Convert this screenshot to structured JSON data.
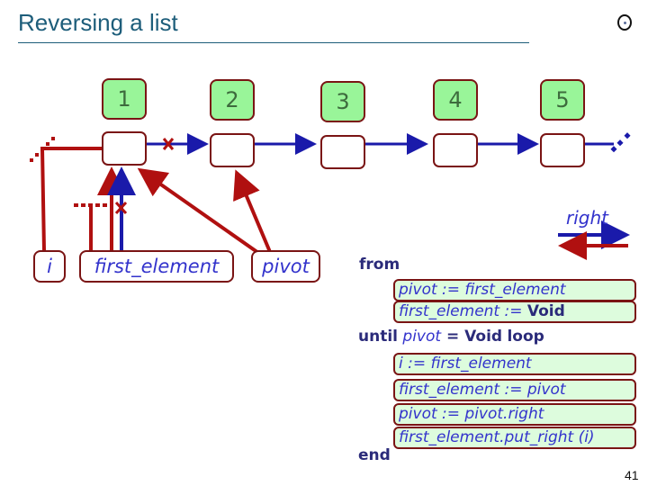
{
  "slide": {
    "title": "Reversing a list",
    "page_number": "41",
    "logo_icon": "circle-dot-logo-icon"
  },
  "list_nodes": [
    {
      "value": "1"
    },
    {
      "value": "2"
    },
    {
      "value": "3"
    },
    {
      "value": "4"
    },
    {
      "value": "5"
    }
  ],
  "variables": [
    {
      "name": "i"
    },
    {
      "name": "first_element"
    },
    {
      "name": "pivot"
    }
  ],
  "legend": {
    "label": "right"
  },
  "code": {
    "from_kw": "from",
    "init_lines": [
      {
        "text": "pivot := first_element",
        "suffix": ""
      },
      {
        "text": "first_element := ",
        "suffix": "Void"
      }
    ],
    "until_kw": "until",
    "cond_var": "pivot",
    "cond_op": " = ",
    "cond_void": "Void",
    "loop_kw": "loop",
    "body_lines": [
      {
        "text": "i := first_element"
      },
      {
        "text": "first_element := pivot"
      },
      {
        "text": "pivot := pivot.right"
      },
      {
        "text": "first_element.put_right (i)"
      }
    ],
    "end_kw": "end"
  },
  "colors": {
    "title": "#1d5d7a",
    "node_fill": "#99f599",
    "node_border": "#7a1414",
    "blue_arrow": "#1a1aaa",
    "red_arrow": "#b01010",
    "code_fill": "#ddfcdd",
    "keyword": "#2b2b7a",
    "identifier": "#3333cc"
  }
}
